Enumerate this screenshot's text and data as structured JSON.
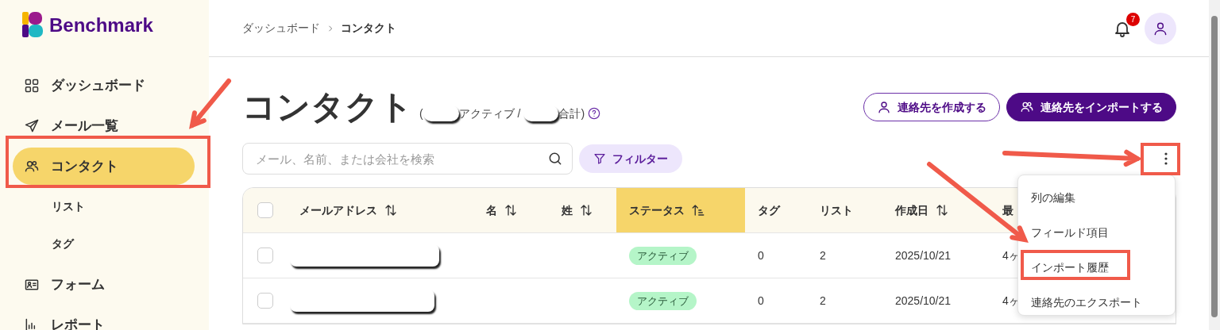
{
  "logo": {
    "text": "Benchmark"
  },
  "sidebar": {
    "items": [
      {
        "label": "ダッシュボード",
        "selected": false
      },
      {
        "label": "メール一覧",
        "selected": false
      },
      {
        "label": "コンタクト",
        "selected": true,
        "children": [
          {
            "label": "リスト",
            "selected": false
          },
          {
            "label": "タグ",
            "selected": false
          }
        ]
      },
      {
        "label": "フォーム",
        "selected": false
      },
      {
        "label": "レポート",
        "selected": false
      }
    ]
  },
  "breadcrumb": [
    "ダッシュボード",
    "コンタクト"
  ],
  "notifications": {
    "count": "7"
  },
  "page": {
    "title": "コンタクト",
    "count_open": "(",
    "count_active": "アクティブ /",
    "count_total": "合計)"
  },
  "buttons": [
    {
      "label": "連絡先を作成する",
      "kind": "outline"
    },
    {
      "label": "連絡先をインポートする",
      "kind": "primary"
    }
  ],
  "search": {
    "placeholder": "メール、名前、または会社を検索"
  },
  "filter": {
    "label": "フィルター"
  },
  "table": {
    "all_checked": false,
    "columns": [
      {
        "label": "メールアドレス",
        "kind": "sortable",
        "selected": false
      },
      {
        "label": "名",
        "kind": "sortable",
        "selected": false
      },
      {
        "label": "姓",
        "kind": "sortable",
        "selected": false
      },
      {
        "label": "ステータス",
        "kind": "sorted",
        "selected": true
      },
      {
        "label": "タグ",
        "selected": false
      },
      {
        "label": "リスト",
        "selected": false
      },
      {
        "label": "作成日",
        "kind": "sortable",
        "selected": false
      },
      {
        "label": "最",
        "selected": false
      }
    ],
    "rows": [
      {
        "checked": false,
        "status": "アクティブ",
        "tags": "0",
        "lists": "2",
        "created": "2025/10/21",
        "column_8": "4ヶ"
      },
      {
        "checked": false,
        "status": "アクティブ",
        "tags": "0",
        "lists": "2",
        "created": "2025/10/21",
        "column_8": "4ヶ"
      }
    ]
  },
  "menu": {
    "items": [
      {
        "label": "列の編集"
      },
      {
        "label": "フィールド項目"
      },
      {
        "label": "インポート履歴"
      },
      {
        "label": "連絡先のエクスポート"
      }
    ]
  }
}
